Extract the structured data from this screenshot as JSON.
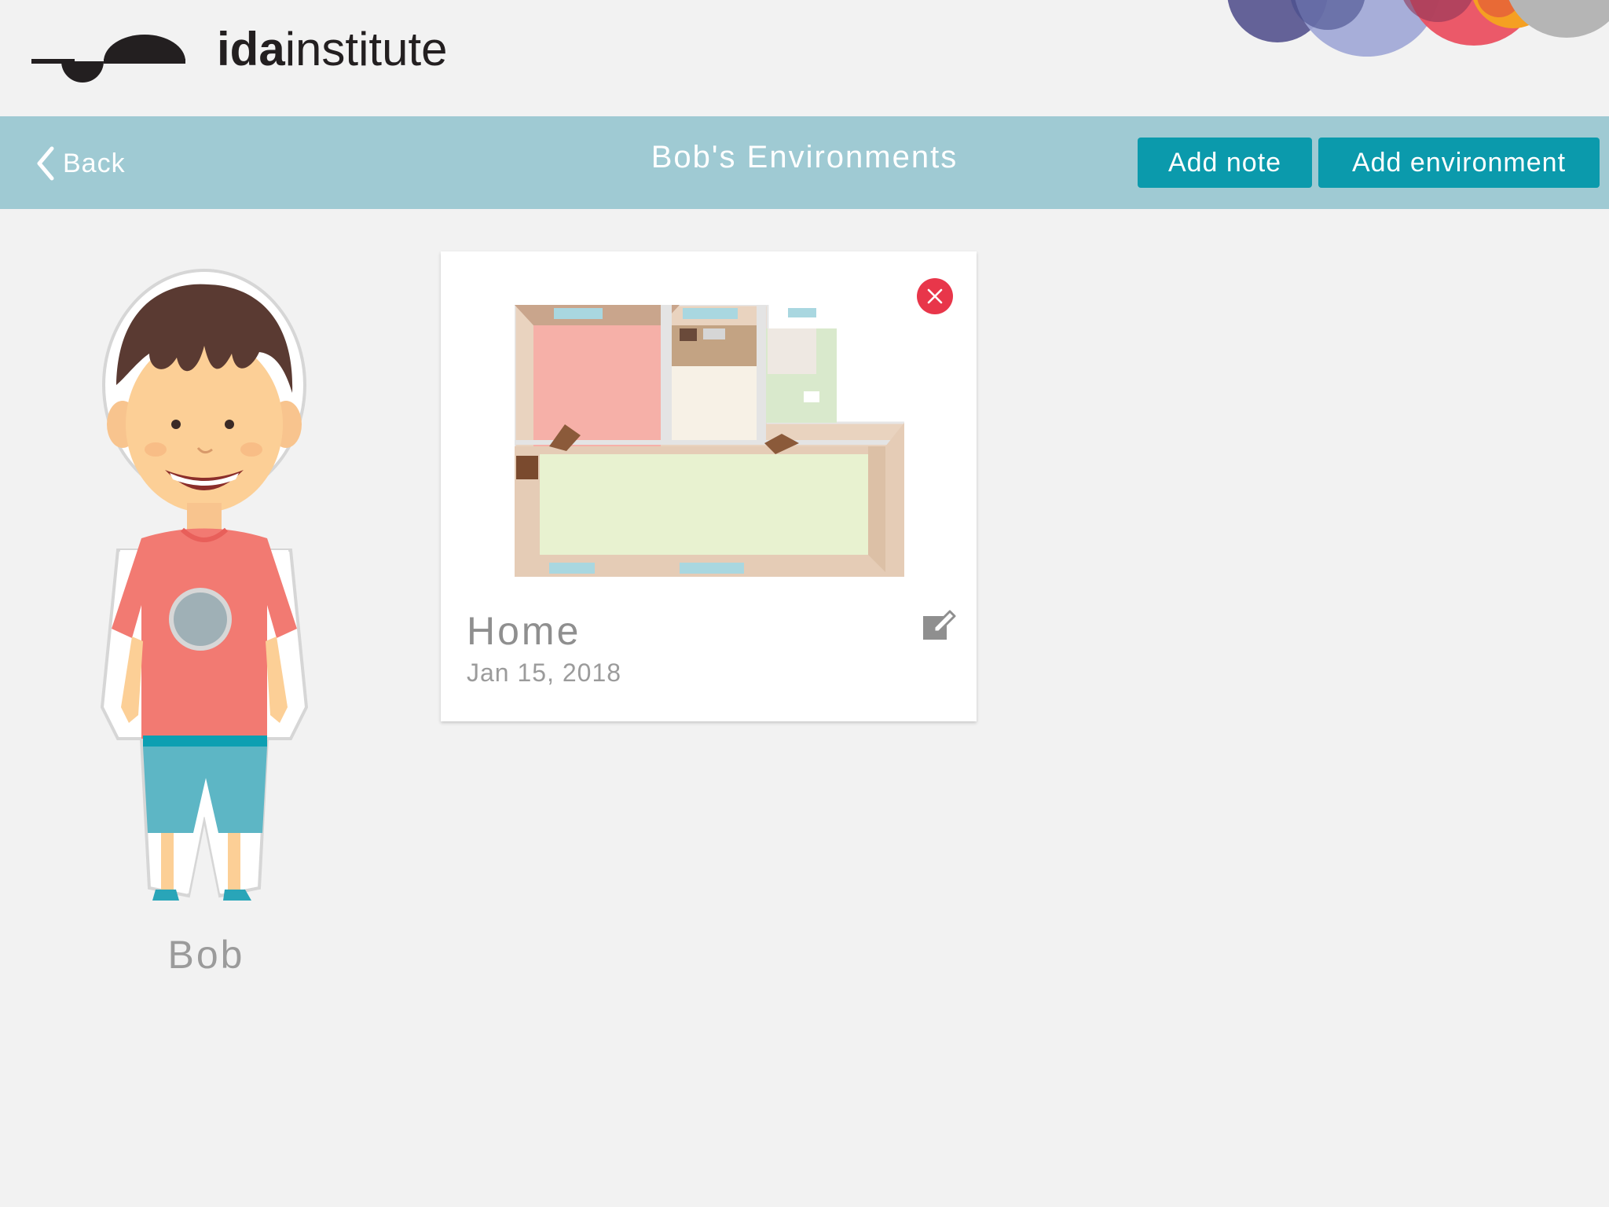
{
  "header": {
    "logo_text_bold": "ida",
    "logo_text_regular": "institute"
  },
  "topbar": {
    "back_label": "Back",
    "title": "Bob's Environments",
    "add_note_label": "Add note",
    "add_environment_label": "Add environment"
  },
  "person": {
    "name": "Bob"
  },
  "environments": [
    {
      "title": "Home",
      "date": "Jan 15, 2018"
    }
  ],
  "colors": {
    "accent": "#0b9aac",
    "bar": "#9fcad3",
    "delete": "#e8364a"
  },
  "icons": [
    "chevron-left-icon",
    "close-icon",
    "edit-icon"
  ]
}
